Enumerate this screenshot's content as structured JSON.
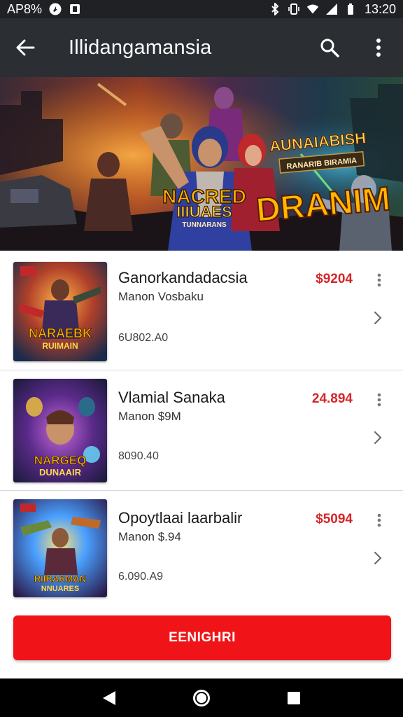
{
  "status_bar": {
    "left_text": "AP8%",
    "time": "13:20"
  },
  "app_bar": {
    "title": "Illidangamansia"
  },
  "banner": {
    "headline": "DRANIM",
    "subheadline": "AUNAIABISH",
    "tagline": "RANARIB BIRAMIA",
    "logo_line1": "NACRED",
    "logo_line2": "IIIUAES",
    "logo_line3": "TUNNARANS"
  },
  "items": [
    {
      "title": "Ganorkandadacsia",
      "subtitle": "Manon Vosbaku",
      "meta": "6U802.A0",
      "price": "$9204",
      "thumb_line1": "NARAEBK",
      "thumb_line2": "RUIMAIN"
    },
    {
      "title": "Vlamial Sanaka",
      "subtitle": "Manon $9M",
      "meta": "8090.40",
      "price": "24.894",
      "thumb_line1": "NARGEQ",
      "thumb_line2": "DUNAAIR"
    },
    {
      "title": "Opoytlaai laarbalir",
      "subtitle": "Manon $.94",
      "meta": "6.090.A9",
      "price": "$5094",
      "thumb_line1": "RIIRARMAN",
      "thumb_line2": "NNUARES"
    }
  ],
  "primary_button": {
    "label": "EENIGHRI"
  },
  "colors": {
    "accent": "#f01418",
    "price": "#d6262a",
    "app_bar": "#2b2e33",
    "status_bar": "#1f2124"
  }
}
